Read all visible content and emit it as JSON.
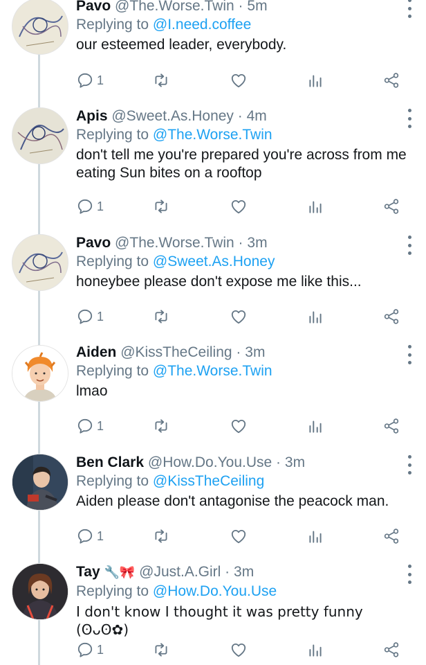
{
  "tweets": [
    {
      "name": "Pavo",
      "emoji": "",
      "handle": "@The.Worse.Twin",
      "time": "5m",
      "replying_label": "Replying to",
      "replying_to": "@I.need.coffee",
      "text": "our esteemed leader, everybody.",
      "reply_count": "1",
      "avatar": "sketch"
    },
    {
      "name": "Apis",
      "emoji": "",
      "handle": "@Sweet.As.Honey",
      "time": "4m",
      "replying_label": "Replying to",
      "replying_to": "@The.Worse.Twin",
      "text": "don't tell me you're prepared you're across from me eating Sun bites on a rooftop",
      "reply_count": "1",
      "avatar": "sketch"
    },
    {
      "name": "Pavo",
      "emoji": "",
      "handle": "@The.Worse.Twin",
      "time": "3m",
      "replying_label": "Replying to",
      "replying_to": "@Sweet.As.Honey",
      "text": "honeybee please don't expose me like this...",
      "reply_count": "1",
      "avatar": "sketch"
    },
    {
      "name": "Aiden",
      "emoji": "",
      "handle": "@KissTheCeiling",
      "time": "3m",
      "replying_label": "Replying to",
      "replying_to": "@The.Worse.Twin",
      "text": "lmao",
      "reply_count": "1",
      "avatar": "orange-hair"
    },
    {
      "name": "Ben Clark",
      "emoji": "",
      "handle": "@How.Do.You.Use",
      "time": "3m",
      "replying_label": "Replying to",
      "replying_to": "@KissTheCeiling",
      "text": "Aiden please don't antagonise the peacock man.",
      "reply_count": "1",
      "avatar": "dark-room"
    },
    {
      "name": "Tay",
      "emoji": "🔧🎀",
      "handle": "@Just.A.Girl",
      "time": "3m",
      "replying_label": "Replying to",
      "replying_to": "@How.Do.You.Use",
      "text": "I don't know I thought it was pretty funny (ʘᴗʘ✿)",
      "reply_count": "1",
      "avatar": "brown-hair"
    }
  ],
  "colors": {
    "link": "#1da1f2",
    "muted": "#657786",
    "text": "#14171a",
    "thread_line": "#cfd9de"
  },
  "icons": [
    "reply-icon",
    "retweet-icon",
    "like-icon",
    "stats-icon",
    "share-icon",
    "more-options-icon"
  ]
}
